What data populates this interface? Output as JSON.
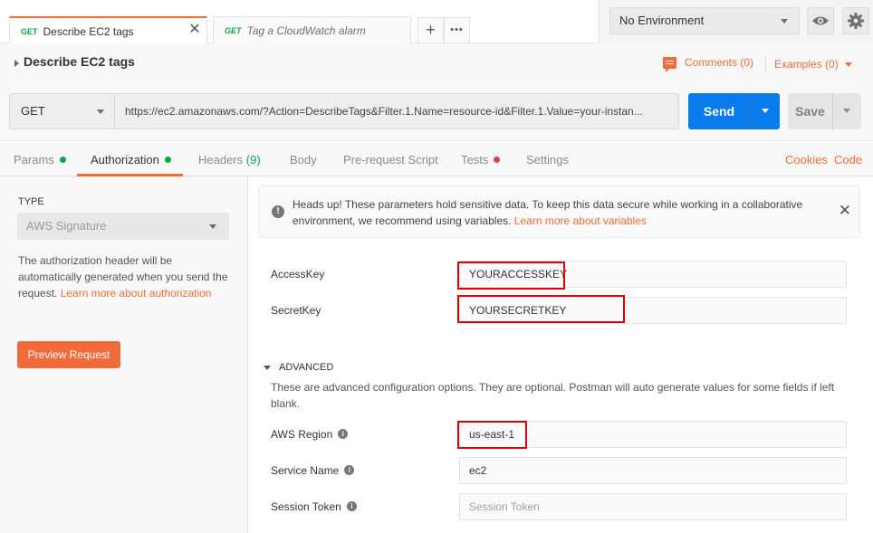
{
  "tabs": [
    {
      "method": "GET",
      "name": "Describe EC2 tags",
      "close": "✕"
    },
    {
      "method": "GET",
      "name": "Tag a CloudWatch alarm"
    }
  ],
  "tab_actions": {
    "add": "+",
    "more": "•••"
  },
  "environment": {
    "selected": "No Environment"
  },
  "request": {
    "title": "Describe EC2 tags",
    "comments": "Comments (0)",
    "examples": "Examples (0)",
    "method": "GET",
    "url": "https://ec2.amazonaws.com/?Action=DescribeTags&Filter.1.Name=resource-id&Filter.1.Value=your-instan...",
    "send_label": "Send",
    "save_label": "Save"
  },
  "subtabs": {
    "params": "Params",
    "authorization": "Authorization",
    "headers": "Headers",
    "headers_count": "(9)",
    "body": "Body",
    "prerequest": "Pre-request Script",
    "tests": "Tests",
    "settings": "Settings",
    "cookies": "Cookies",
    "code": "Code"
  },
  "auth": {
    "type_label": "TYPE",
    "type_value": "AWS Signature",
    "desc_text": "The authorization header will be automatically generated when you send the request.",
    "desc_link": "Learn more about authorization",
    "preview_button": "Preview Request"
  },
  "alert": {
    "text": "Heads up! These parameters hold sensitive data. To keep this data secure while working in a collaborative environment, we recommend using variables.",
    "link": "Learn more about variables",
    "icon": "!",
    "close": "✕"
  },
  "fields": {
    "access_key_label": "AccessKey",
    "access_key_value": "YOURACCESSKEY",
    "secret_key_label": "SecretKey",
    "secret_key_value": "YOURSECRETKEY"
  },
  "advanced": {
    "title": "ADVANCED",
    "desc": "These are advanced configuration options. They are optional. Postman will auto generate values for some fields if left blank.",
    "region_label": "AWS Region",
    "region_value": "us-east-1",
    "service_label": "Service Name",
    "service_value": "ec2",
    "session_label": "Session Token",
    "session_placeholder": "Session Token",
    "info_icon": "i"
  },
  "colors": {
    "accent": "#f26b3a",
    "send": "#097bed",
    "status_green": "#10a54a",
    "status_red": "#e0413a",
    "highlight": "#e00000"
  }
}
